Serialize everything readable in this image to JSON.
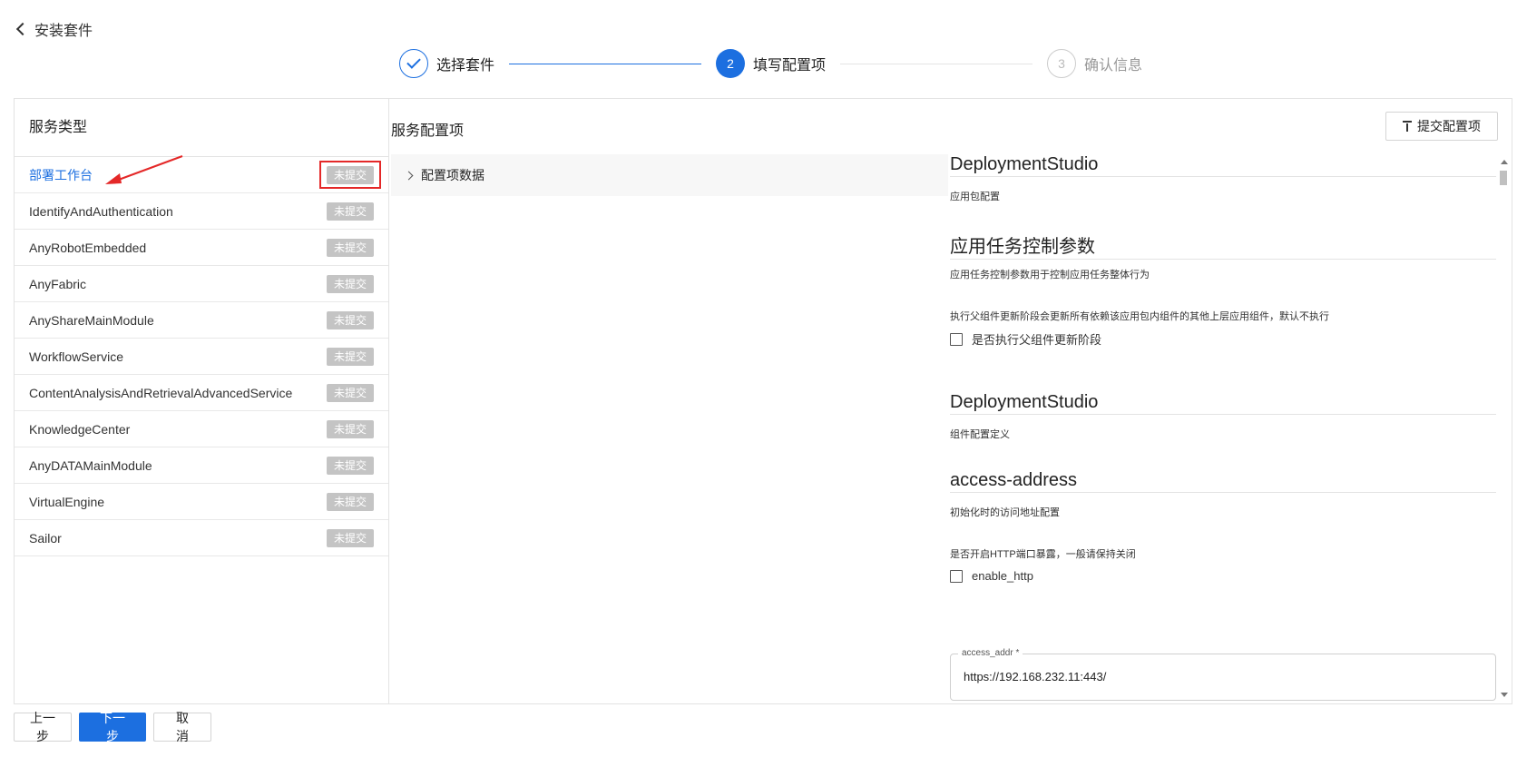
{
  "header": {
    "back_title": "安装套件"
  },
  "steps": [
    {
      "label": "选择套件",
      "number": "1",
      "state": "done"
    },
    {
      "label": "填写配置项",
      "number": "2",
      "state": "active"
    },
    {
      "label": "确认信息",
      "number": "3",
      "state": "todo"
    }
  ],
  "left": {
    "title": "服务类型",
    "services": [
      {
        "name": "部署工作台",
        "status": "未提交"
      },
      {
        "name": "IdentifyAndAuthentication",
        "status": "未提交"
      },
      {
        "name": "AnyRobotEmbedded",
        "status": "未提交"
      },
      {
        "name": "AnyFabric",
        "status": "未提交"
      },
      {
        "name": "AnyShareMainModule",
        "status": "未提交"
      },
      {
        "name": "WorkflowService",
        "status": "未提交"
      },
      {
        "name": "ContentAnalysisAndRetrievalAdvancedService",
        "status": "未提交"
      },
      {
        "name": "KnowledgeCenter",
        "status": "未提交"
      },
      {
        "name": "AnyDATAMainModule",
        "status": "未提交"
      },
      {
        "name": "VirtualEngine",
        "status": "未提交"
      },
      {
        "name": "Sailor",
        "status": "未提交"
      }
    ]
  },
  "main": {
    "title": "服务配置项",
    "submit_label": "提交配置项",
    "tree_item": "配置项数据",
    "form": {
      "s1_title": "DeploymentStudio",
      "s1_desc": "应用包配置",
      "s2_title": "应用任务控制参数",
      "s2_desc": "应用任务控制参数用于控制应用任务整体行为",
      "s2_field_desc": "执行父组件更新阶段会更新所有依赖该应用包内组件的其他上层应用组件，默认不执行",
      "s2_checkbox": "是否执行父组件更新阶段",
      "s3_title": "DeploymentStudio",
      "s3_desc": "组件配置定义",
      "s4_title": "access-address",
      "s4_desc": "初始化时的访问地址配置",
      "s4_field_desc": "是否开启HTTP端口暴露，一般请保持关闭",
      "s4_checkbox": "enable_http",
      "access_addr_label": "access_addr *",
      "access_addr_value": "https://192.168.232.11:443/"
    }
  },
  "footer": {
    "prev": "上一步",
    "next": "下一步",
    "cancel": "取 消"
  },
  "colors": {
    "primary": "#1c6fe0",
    "badge": "#c4c4c4",
    "highlight": "#e42828"
  }
}
